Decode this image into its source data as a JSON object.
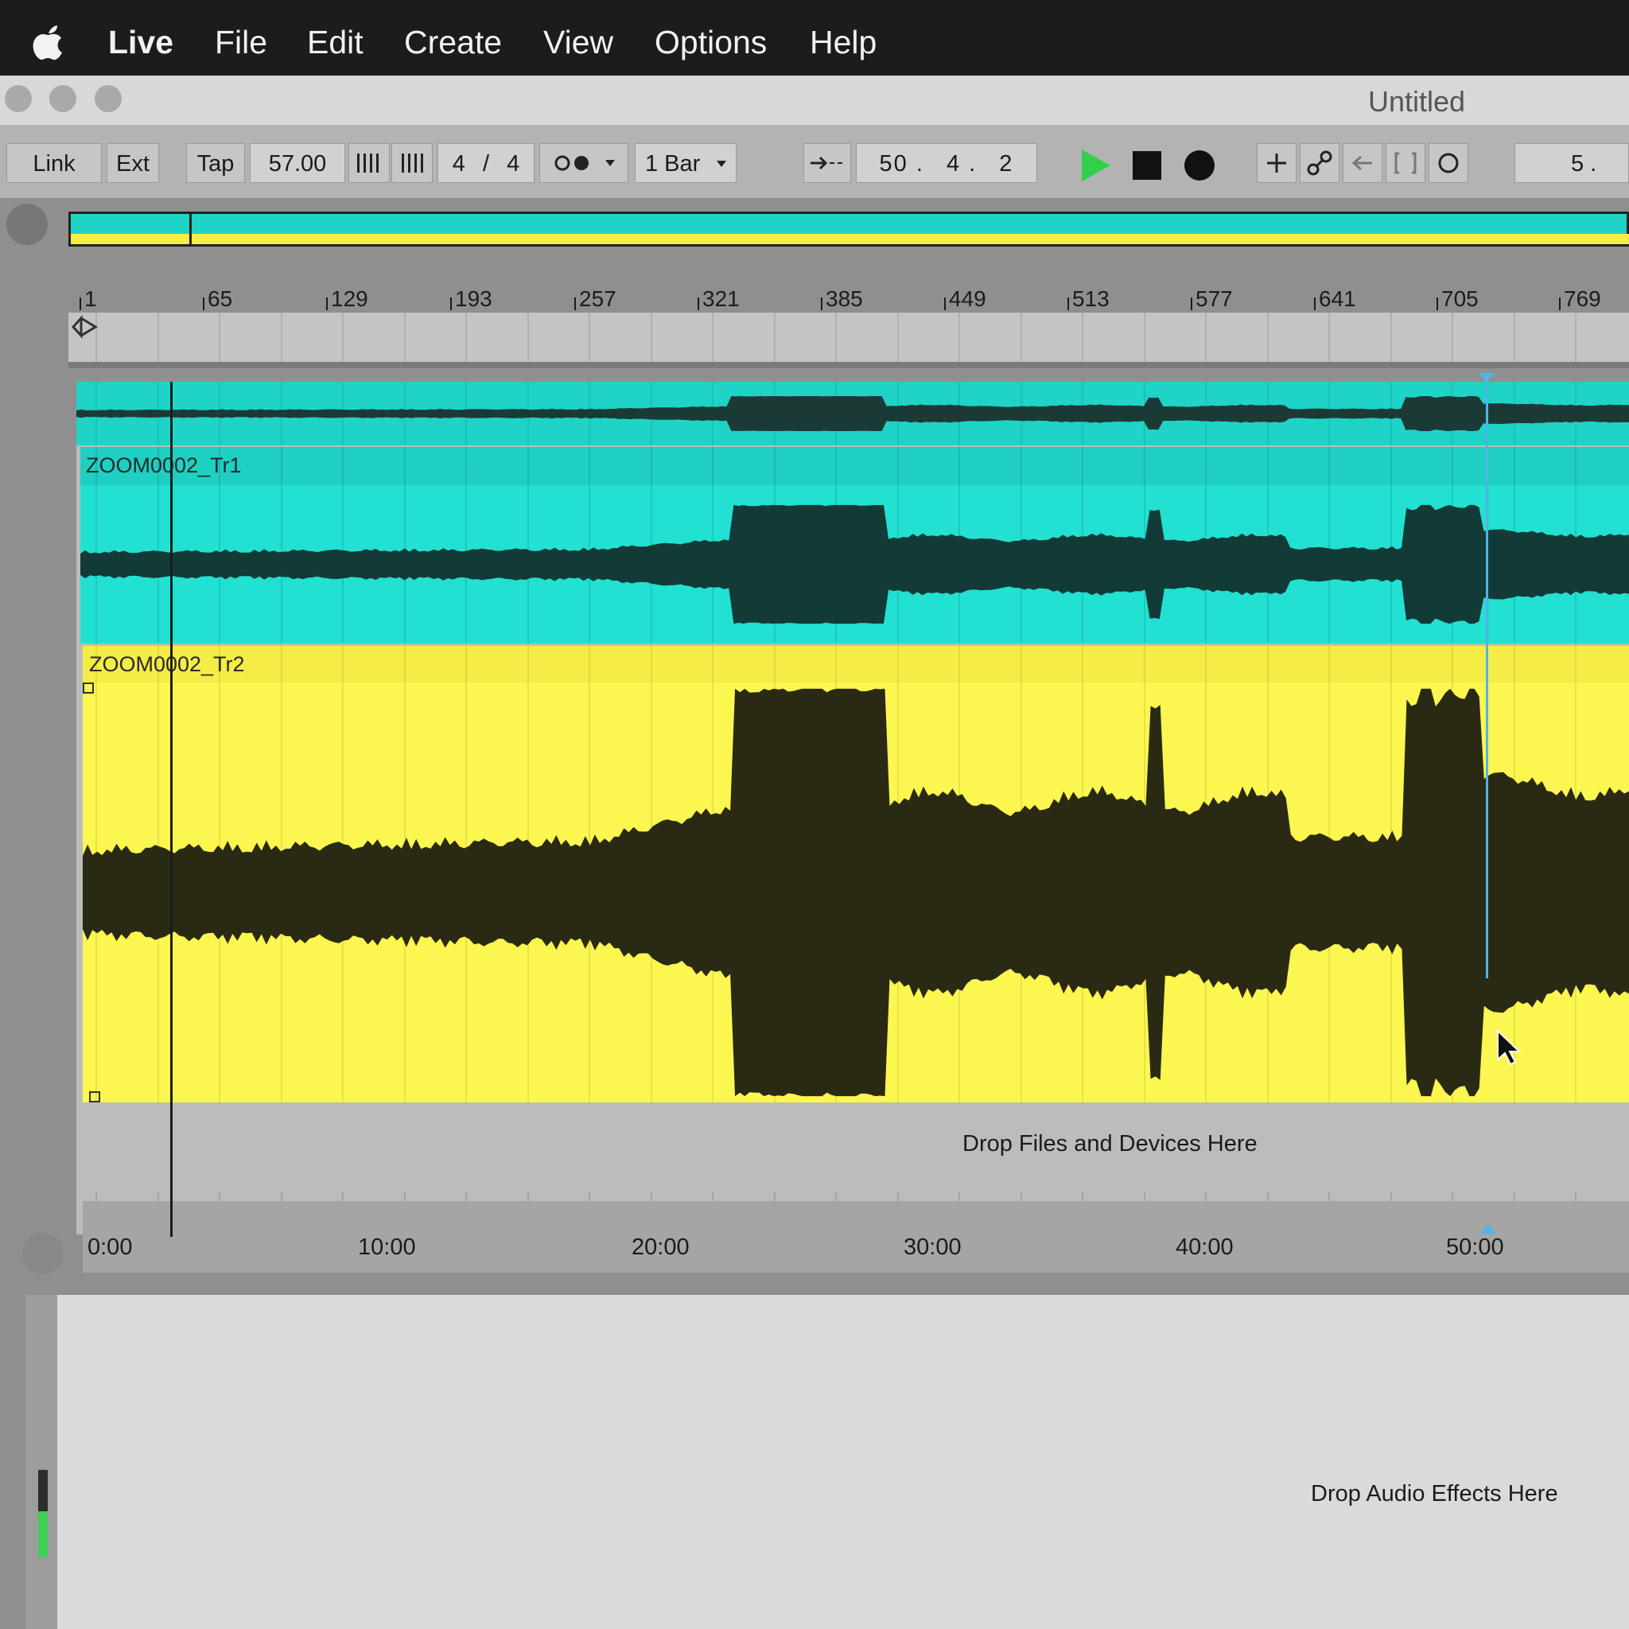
{
  "menubar": {
    "apple_icon": "apple-icon",
    "items": [
      "Live",
      "File",
      "Edit",
      "Create",
      "View",
      "Options",
      "Help"
    ]
  },
  "window": {
    "title": "Untitled"
  },
  "transport": {
    "link": "Link",
    "ext": "Ext",
    "tap": "Tap",
    "tempo": "57.00",
    "time_sig_num": "4",
    "time_sig_sep": "/",
    "time_sig_den": "4",
    "quantize": "1 Bar",
    "position": [
      "50",
      "4",
      "2"
    ],
    "position_right": "5 .",
    "play_color": "#32d04a"
  },
  "arrangement": {
    "bar_numbers": [
      "1",
      "65",
      "129",
      "193",
      "257",
      "321",
      "385",
      "449",
      "513",
      "577",
      "641",
      "705",
      "769"
    ],
    "clips": [
      {
        "name": "ZOOM0002_Tr1",
        "color": "#22e0d2"
      },
      {
        "name": "ZOOM0002_Tr2",
        "color": "#fcf650"
      }
    ],
    "drop_hint": "Drop Files and Devices Here",
    "time_labels": [
      "0:00",
      "10:00",
      "20:00",
      "30:00",
      "40:00",
      "50:00"
    ]
  },
  "detail": {
    "drop_hint": "Drop Audio Effects Here"
  }
}
